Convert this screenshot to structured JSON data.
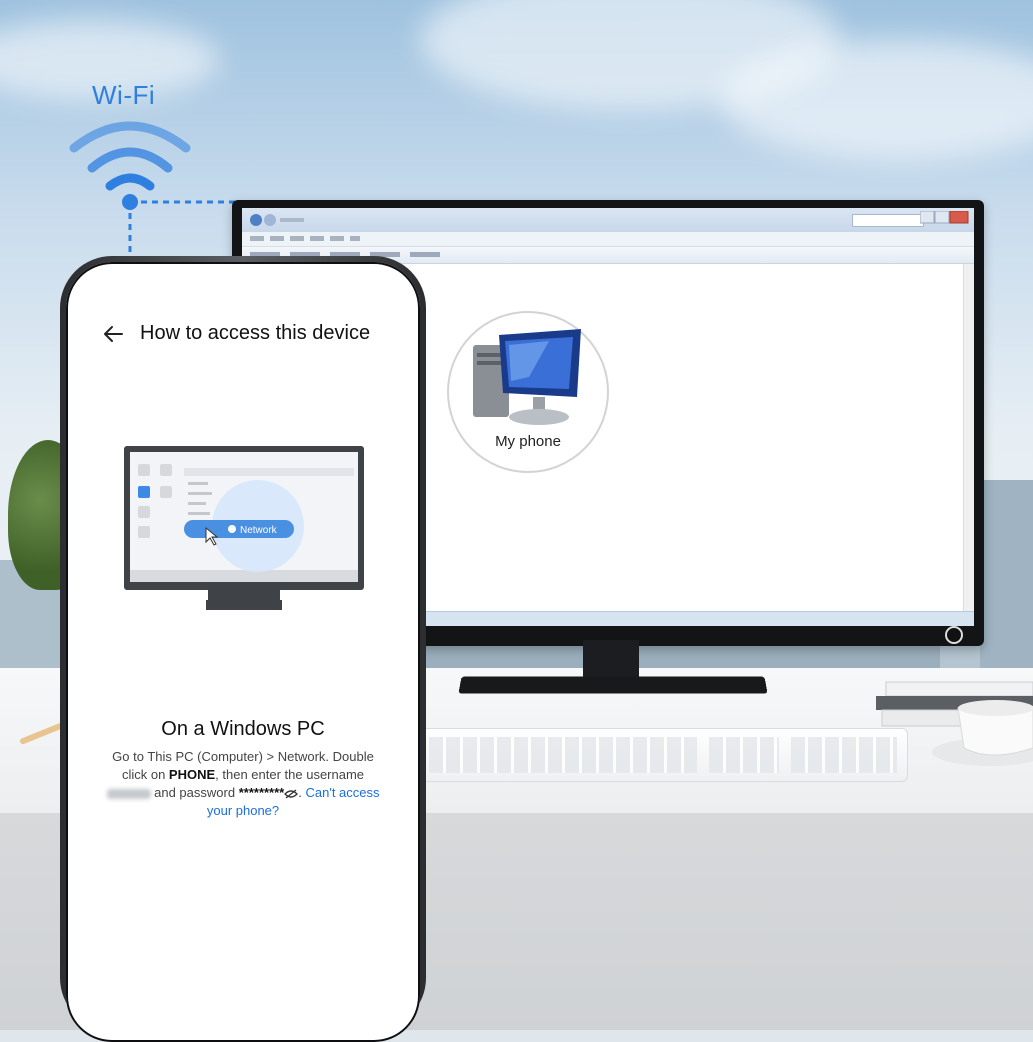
{
  "wifi": {
    "label": "Wi-Fi",
    "color": "#2f7fe0"
  },
  "monitor": {
    "icon_label": "My phone"
  },
  "phone": {
    "title": "How to access this device",
    "illustration": {
      "network_label": "Network"
    },
    "heading": "On a Windows PC",
    "body": {
      "part1": "Go to This PC (Computer) > Network. Double click on ",
      "device_name": "PHONE",
      "part2": ", then enter the username",
      "part3": "and password",
      "password_mask": "*********",
      "link": "Can't access your phone?"
    }
  },
  "colors": {
    "accent": "#1a6fe0",
    "network_bubble": "#4a90e2"
  }
}
